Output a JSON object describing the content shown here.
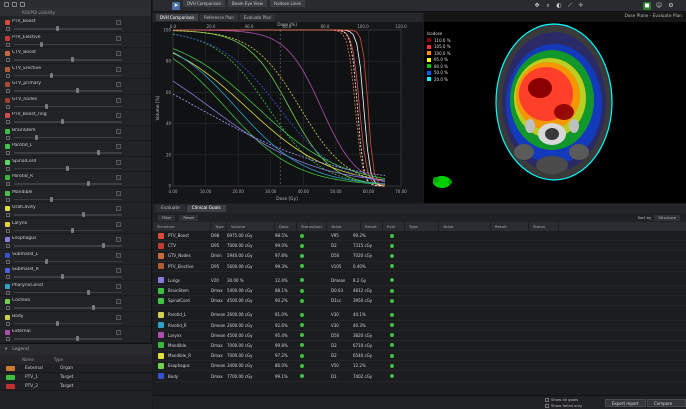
{
  "left_panel": {
    "header": "ROI/POI visibility",
    "rows": [
      {
        "name": "PTV_Boost",
        "color": "#d94a3a",
        "knob": 0.4
      },
      {
        "name": "PTV_Elective",
        "color": "#c43b33",
        "knob": 0.25
      },
      {
        "name": "CTV_Boost",
        "color": "#c86a3a",
        "knob": 0.55
      },
      {
        "name": "CTV_Elective",
        "color": "#b35a30",
        "knob": 0.35
      },
      {
        "name": "GTV_primary",
        "color": "#a84a2f",
        "knob": 0.6
      },
      {
        "name": "GTV_nodes",
        "color": "#9e4030",
        "knob": 0.3
      },
      {
        "name": "PTV_Boost_ring",
        "color": "#d44a4a",
        "knob": 0.45
      },
      {
        "name": "BrainStem",
        "color": "#3fbf3f",
        "knob": 0.2
      },
      {
        "name": "Parotid_L",
        "color": "#44c444",
        "knob": 0.8
      },
      {
        "name": "SpinalCord",
        "color": "#5bd85b",
        "knob": 0.5
      },
      {
        "name": "Parotid_R",
        "color": "#3ab83a",
        "knob": 0.7
      },
      {
        "name": "Mandible",
        "color": "#4ac24a",
        "knob": 0.35
      },
      {
        "name": "OralCavity",
        "color": "#e0e040",
        "knob": 0.65
      },
      {
        "name": "Larynx",
        "color": "#e6d23c",
        "knob": 0.55
      },
      {
        "name": "Esophagus",
        "color": "#8a7ae0",
        "knob": 0.85
      },
      {
        "name": "Submand_L",
        "color": "#3850d0",
        "knob": 0.3
      },
      {
        "name": "Submand_R",
        "color": "#4d5fd8",
        "knob": 0.45
      },
      {
        "name": "PharynxConst",
        "color": "#2fa0c8",
        "knob": 0.7
      },
      {
        "name": "Cochlea",
        "color": "#6fd24f",
        "knob": 0.75
      },
      {
        "name": "Body",
        "color": "#cfcf52",
        "knob": 0.4
      },
      {
        "name": "External",
        "color": "#b04cb0",
        "knob": 0.6
      }
    ],
    "legend_title": "Legend",
    "legend_cols": [
      "Name",
      "Type"
    ],
    "legend_rows": [
      {
        "name": "External",
        "type": "Organ",
        "color": "#cc7a30"
      },
      {
        "name": "PTV_1",
        "type": "Target",
        "color": "#3fbf3f"
      },
      {
        "name": "PTV_2",
        "type": "Target",
        "color": "#c03030"
      }
    ]
  },
  "toolbar": {
    "tabs": [
      "DVH Comparison",
      "Beam Eye View",
      "Isodose Lines"
    ],
    "tool_icons": [
      "pointer-icon",
      "pan-icon",
      "zoom-icon",
      "window-level-icon",
      "measure-icon",
      "crosshair-icon",
      "contour-icon",
      "settings-icon"
    ]
  },
  "dvh": {
    "tabs": [
      "DVH Comparison",
      "Reference Plan",
      "Evaluate Plan"
    ],
    "x_label": "Dose [Gy]",
    "y_label": "Volume [%]",
    "top_axis_label": "Dose [%]",
    "x_ticks": [
      "0.00",
      "10.00",
      "20.00",
      "30.00",
      "40.00",
      "50.00",
      "60.00",
      "70.00"
    ],
    "top_ticks": [
      "0.0",
      "20.0",
      "40.0",
      "60.0",
      "80.0",
      "100.0",
      "120.0"
    ],
    "y_ticks": [
      "100",
      "80",
      "60",
      "40",
      "20",
      "0"
    ]
  },
  "ct": {
    "title": "Dose Plane - Evaluate Plan",
    "isodose_title": "Isodose",
    "isodose_levels": [
      {
        "label": "110.0 %",
        "color": "#8b0000"
      },
      {
        "label": "105.0 %",
        "color": "#ff3030"
      },
      {
        "label": "100.0 %",
        "color": "#ff8c00"
      },
      {
        "label": "95.0 %",
        "color": "#ffff00"
      },
      {
        "label": "80.0 %",
        "color": "#00c000"
      },
      {
        "label": "50.0 %",
        "color": "#0060ff"
      },
      {
        "label": "20.0 %",
        "color": "#00ffff"
      }
    ]
  },
  "table": {
    "tabs": [
      "Evaluate",
      "Clinical Goals"
    ],
    "tools": [
      "Filter",
      "Reset"
    ],
    "right_label": "Sort by",
    "right_value": "Structure",
    "headers": [
      "Structure",
      "Type",
      "Volume",
      "Dose",
      "Status",
      "Goal",
      "Value",
      "Result",
      "Eval",
      "Type",
      "Value",
      "Result",
      "Status"
    ],
    "rows": [
      {
        "name": "PTV_Boost",
        "color": "#d94a3a",
        "a": "D98",
        "b": "6975.00 cGy",
        "c": "98.5%",
        "d": "V95",
        "e": "99.2%"
      },
      {
        "name": "CTV",
        "color": "#c43b33",
        "a": "D95",
        "b": "7000.00 cGy",
        "c": "99.0%",
        "d": "D2",
        "e": "7315 cGy"
      },
      {
        "name": "GTV_Nodes",
        "color": "#c86a3a",
        "a": "Dmin",
        "b": "5940.00 cGy",
        "c": "97.8%",
        "d": "D50",
        "e": "7020 cGy"
      },
      {
        "name": "PTV_Elective",
        "color": "#b35a30",
        "a": "D95",
        "b": "5600.00 cGy",
        "c": "99.3%",
        "d": "V105",
        "e": "0.40%"
      },
      {
        "sep": true
      },
      {
        "name": "Lungs",
        "color": "#8a7ae0",
        "a": "V20",
        "b": "30.00 %",
        "c": "12.4%",
        "d": "Dmean",
        "e": "8.2 Gy"
      },
      {
        "name": "BrainStem",
        "color": "#3fbf3f",
        "a": "Dmax",
        "b": "5400.00 cGy",
        "c": "88.1%",
        "d": "D0.03",
        "e": "4812 cGy"
      },
      {
        "name": "SpinalCord",
        "color": "#44c444",
        "a": "Dmax",
        "b": "4500.00 cGy",
        "c": "90.2%",
        "d": "D1cc",
        "e": "3950 cGy"
      },
      {
        "sep": true
      },
      {
        "name": "Parotid_L",
        "color": "#cfcf52",
        "a": "Dmean",
        "b": "2600.00 cGy",
        "c": "81.0%",
        "d": "V30",
        "e": "44.1%"
      },
      {
        "name": "Parotid_R",
        "color": "#2fa0c8",
        "a": "Dmean",
        "b": "2600.00 cGy",
        "c": "92.6%",
        "d": "V30",
        "e": "40.3%"
      },
      {
        "name": "Larynx",
        "color": "#b04cb0",
        "a": "Dmean",
        "b": "4500.00 cGy",
        "c": "95.4%",
        "d": "D50",
        "e": "3820 cGy"
      },
      {
        "name": "Mandible",
        "color": "#3ab83a",
        "a": "Dmax",
        "b": "7000.00 cGy",
        "c": "99.8%",
        "d": "D2",
        "e": "6710 cGy"
      },
      {
        "name": "Mandible_R",
        "color": "#e0e040",
        "a": "Dmax",
        "b": "7000.00 cGy",
        "c": "97.2%",
        "d": "D2",
        "e": "6540 cGy"
      },
      {
        "name": "Esophagus",
        "color": "#6fd24f",
        "a": "Dmean",
        "b": "3400.00 cGy",
        "c": "86.0%",
        "d": "V50",
        "e": "12.2%"
      },
      {
        "name": "Body",
        "color": "#3850d0",
        "a": "Dmax",
        "b": "7700.00 cGy",
        "c": "99.1%",
        "d": "D1",
        "e": "7402 cGy"
      }
    ],
    "bottom": {
      "checkbox1": "Show all goals",
      "checkbox2": "Show failed only",
      "btn1": "Export report",
      "btn2": "Compare plans"
    }
  }
}
